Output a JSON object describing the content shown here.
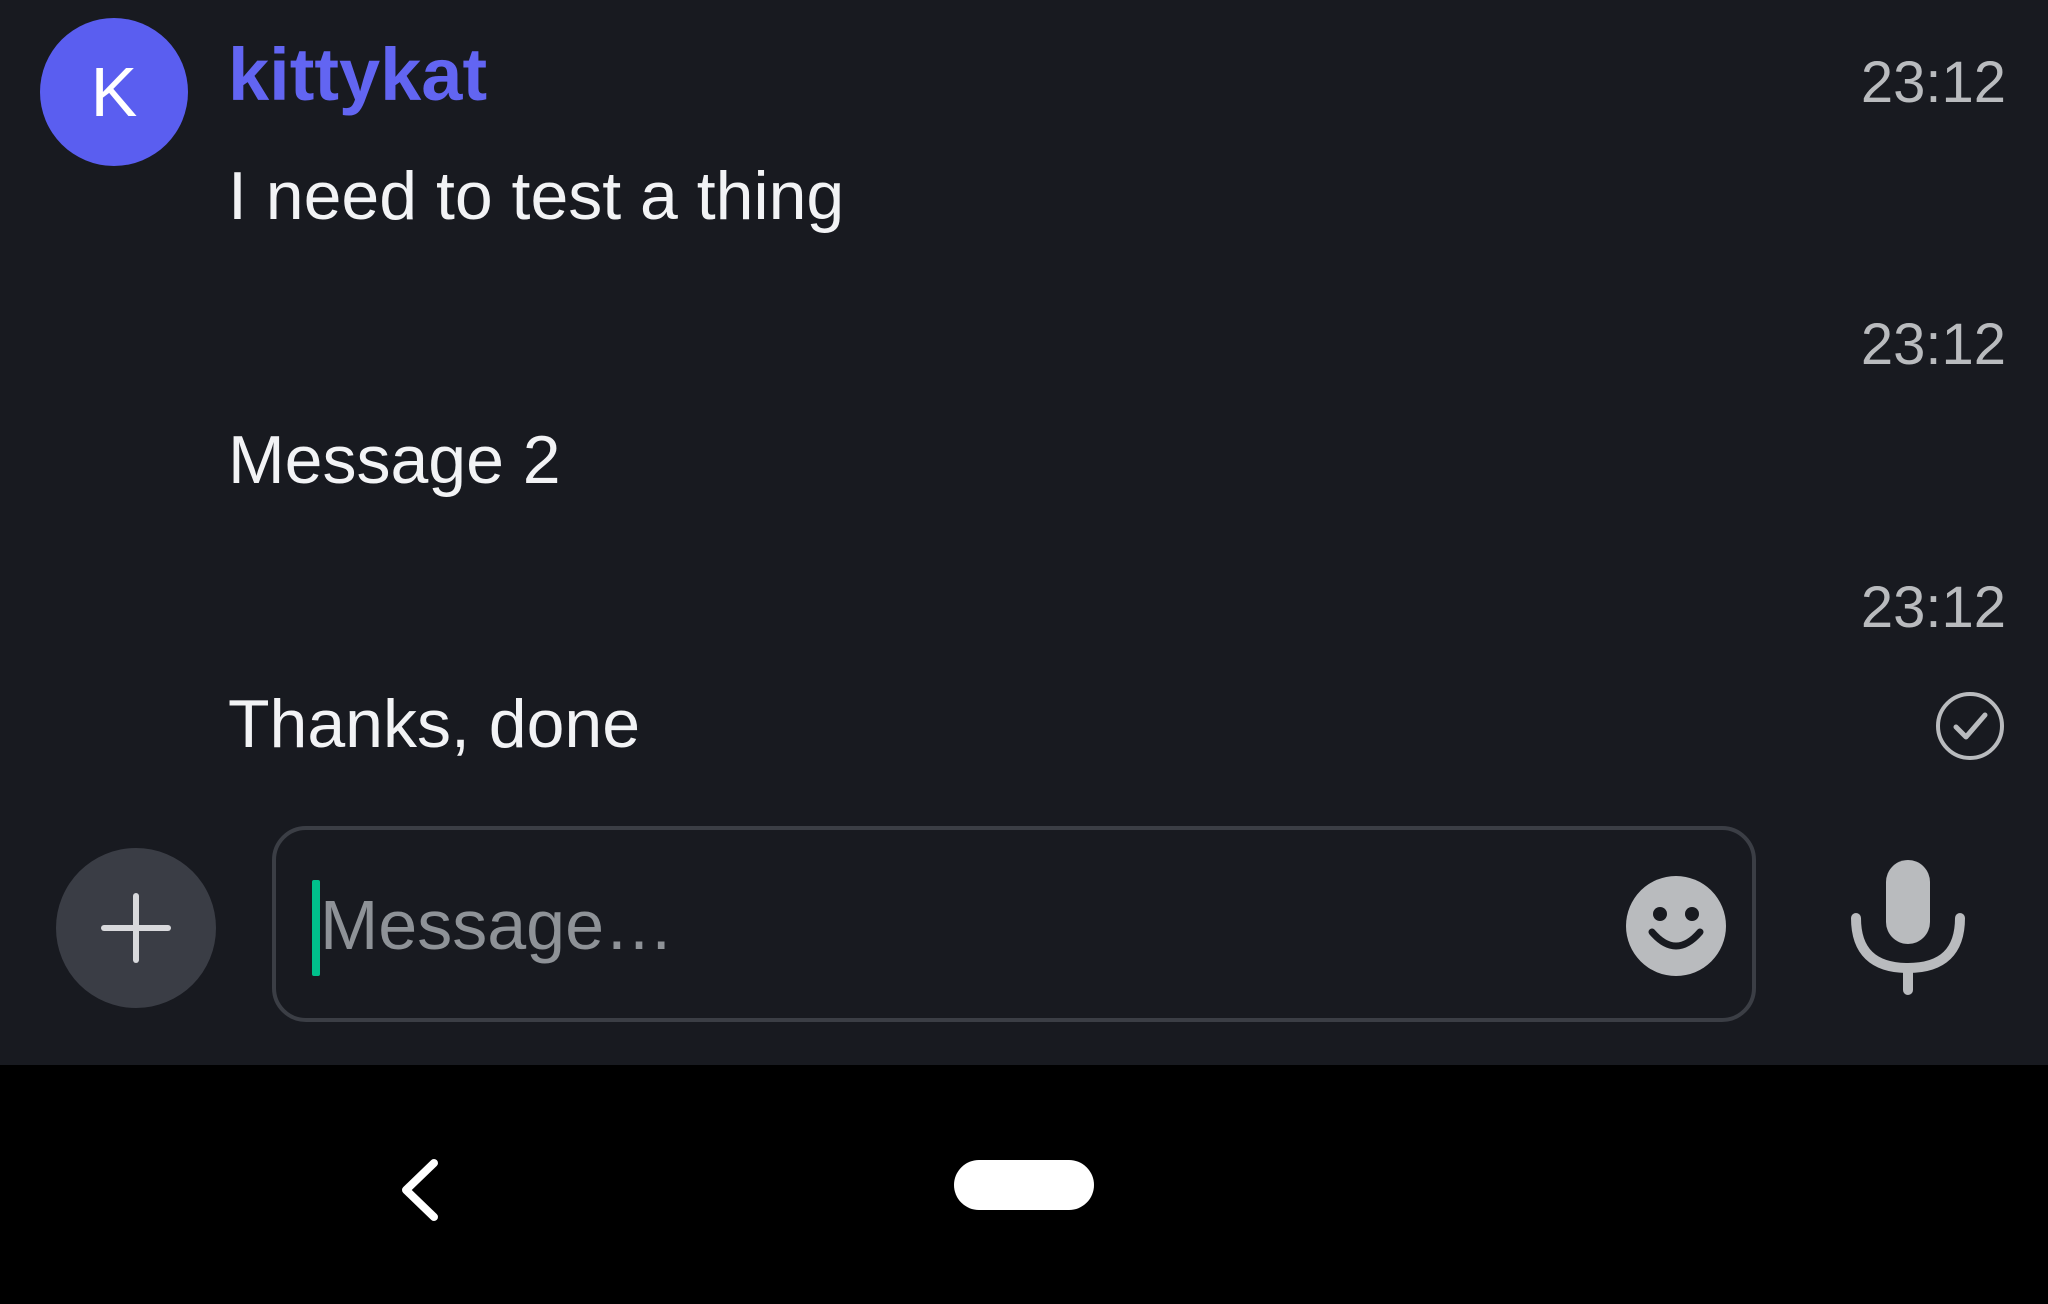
{
  "messages": {
    "author": {
      "name": "kittykat",
      "avatar_initial": "K"
    },
    "items": [
      {
        "text": "I need to test a thing",
        "time": "23:12"
      },
      {
        "text": "Message 2",
        "time": "23:12"
      },
      {
        "text": "Thanks, done",
        "time": "23:12",
        "status_icon": "sent-check-icon"
      }
    ]
  },
  "composer": {
    "placeholder": "Message…",
    "value": "",
    "icons": {
      "add": "plus-icon",
      "emoji": "smiley-icon",
      "voice": "microphone-icon"
    }
  },
  "system_nav": {
    "icons": {
      "back": "back-chevron-icon",
      "home": "home-pill-icon"
    }
  },
  "colors": {
    "background": "#181a20",
    "accent": "#5a5ef0",
    "username": "#6265f2",
    "caret": "#00c08b"
  }
}
